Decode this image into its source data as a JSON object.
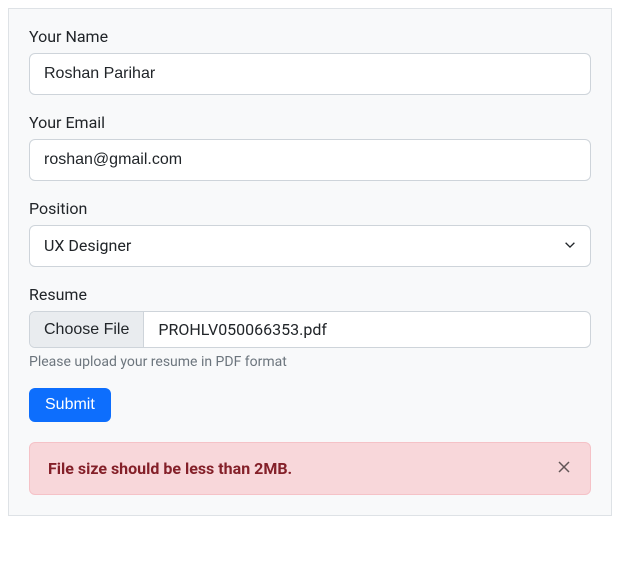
{
  "form": {
    "name": {
      "label": "Your Name",
      "value": "Roshan Parihar"
    },
    "email": {
      "label": "Your Email",
      "value": "roshan@gmail.com"
    },
    "position": {
      "label": "Position",
      "value": "UX Designer"
    },
    "resume": {
      "label": "Resume",
      "choose_label": "Choose File",
      "filename": "PROHLV050066353.pdf",
      "help_text": "Please upload your resume in PDF format"
    },
    "submit_label": "Submit"
  },
  "alert": {
    "message": "File size should be less than 2MB."
  }
}
